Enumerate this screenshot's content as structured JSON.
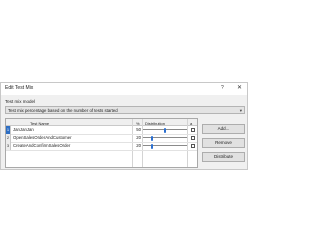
{
  "window": {
    "title": "Edit Test Mix",
    "help_glyph": "?",
    "close_glyph": "✕"
  },
  "model": {
    "label": "Test mix model",
    "selected": "Test mix percentage based on the number of tests started",
    "arrow_glyph": "▾"
  },
  "grid": {
    "headers": {
      "test_name": "Test Name",
      "percent": "%",
      "distribution": "Distribution",
      "lock": "a"
    },
    "rows": [
      {
        "index": "1",
        "name": "JanJanJan",
        "percent": "50",
        "distribution": 0.5,
        "locked": false
      },
      {
        "index": "2",
        "name": "OpenSalesOrderAndCustomer",
        "percent": "20",
        "distribution": 0.2,
        "locked": false
      },
      {
        "index": "3",
        "name": "CreateAndConfirmSalesOrder",
        "percent": "20",
        "distribution": 0.2,
        "locked": false
      }
    ]
  },
  "buttons": {
    "add": "Add...",
    "remove": "Remove",
    "distribute": "Distribute"
  },
  "colors": {
    "selected_row": "#2d6ec4",
    "slider_thumb": "#2b6fd0"
  }
}
